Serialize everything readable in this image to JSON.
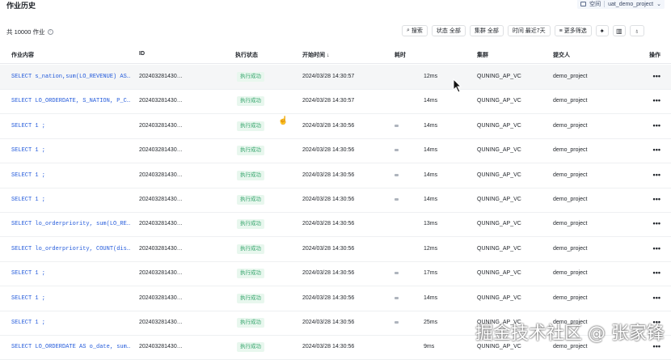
{
  "header": {
    "title": "作业历史",
    "workspace_label": "空间",
    "workspace_name": "uat_demo_project"
  },
  "summary": {
    "count_text": "共 10000 作业"
  },
  "toolbar": {
    "search": "搜索",
    "status": "状态 全部",
    "cluster": "集群 全部",
    "time": "时间 最近7天",
    "more_filters": "更多筛选"
  },
  "columns": {
    "content": "作业内容",
    "id": "ID",
    "status": "执行状态",
    "start": "开始时间 ↓",
    "duration": "耗时",
    "cluster": "集群",
    "submitter": "提交人",
    "action": "操作"
  },
  "rows": [
    {
      "sql": "SELECT s_nation,sum(LO_REVENUE) AS…",
      "id": "202403281430…",
      "status": "执行成功",
      "start": "2024/03/28 14:30:57",
      "duration": "12ms",
      "cluster": "QUNING_AP_VC",
      "submitter": "demo_project",
      "bar": false
    },
    {
      "sql": "SELECT LO_ORDERDATE, S_NATION, P_C…",
      "id": "202403281430…",
      "status": "执行成功",
      "start": "2024/03/28 14:30:57",
      "duration": "14ms",
      "cluster": "QUNING_AP_VC",
      "submitter": "demo_project",
      "bar": false
    },
    {
      "sql": "SELECT 1 ;",
      "id": "202403281430…",
      "status": "执行成功",
      "start": "2024/03/28 14:30:56",
      "duration": "14ms",
      "cluster": "QUNING_AP_VC",
      "submitter": "demo_project",
      "bar": true
    },
    {
      "sql": "SELECT 1 ;",
      "id": "202403281430…",
      "status": "执行成功",
      "start": "2024/03/28 14:30:56",
      "duration": "14ms",
      "cluster": "QUNING_AP_VC",
      "submitter": "demo_project",
      "bar": true
    },
    {
      "sql": "SELECT 1 ;",
      "id": "202403281430…",
      "status": "执行成功",
      "start": "2024/03/28 14:30:56",
      "duration": "14ms",
      "cluster": "QUNING_AP_VC",
      "submitter": "demo_project",
      "bar": true
    },
    {
      "sql": "SELECT 1 ;",
      "id": "202403281430…",
      "status": "执行成功",
      "start": "2024/03/28 14:30:56",
      "duration": "14ms",
      "cluster": "QUNING_AP_VC",
      "submitter": "demo_project",
      "bar": true
    },
    {
      "sql": "SELECT lo_orderpriority, sum(LO_RE…",
      "id": "202403281430…",
      "status": "执行成功",
      "start": "2024/03/28 14:30:56",
      "duration": "13ms",
      "cluster": "QUNING_AP_VC",
      "submitter": "demo_project",
      "bar": false
    },
    {
      "sql": "SELECT lo_orderpriority, COUNT(dis…",
      "id": "202403281430…",
      "status": "执行成功",
      "start": "2024/03/28 14:30:56",
      "duration": "12ms",
      "cluster": "QUNING_AP_VC",
      "submitter": "demo_project",
      "bar": false
    },
    {
      "sql": "SELECT 1 ;",
      "id": "202403281430…",
      "status": "执行成功",
      "start": "2024/03/28 14:30:56",
      "duration": "17ms",
      "cluster": "QUNING_AP_VC",
      "submitter": "demo_project",
      "bar": true
    },
    {
      "sql": "SELECT 1 ;",
      "id": "202403281430…",
      "status": "执行成功",
      "start": "2024/03/28 14:30:56",
      "duration": "14ms",
      "cluster": "QUNING_AP_VC",
      "submitter": "demo_project",
      "bar": true
    },
    {
      "sql": "SELECT 1 ;",
      "id": "202403281430…",
      "status": "执行成功",
      "start": "2024/03/28 14:30:56",
      "duration": "25ms",
      "cluster": "QUNING_AP_VC",
      "submitter": "demo_project",
      "bar": true
    },
    {
      "sql": "SELECT LO_ORDERDATE AS o_date, sum…",
      "id": "202403281430…",
      "status": "执行成功",
      "start": "2024/03/28 14:30:56",
      "duration": "9ms",
      "cluster": "QUNING_AP_VC",
      "submitter": "demo_project",
      "bar": false
    }
  ],
  "watermark": "掘金技术社区 @ 张家锋"
}
